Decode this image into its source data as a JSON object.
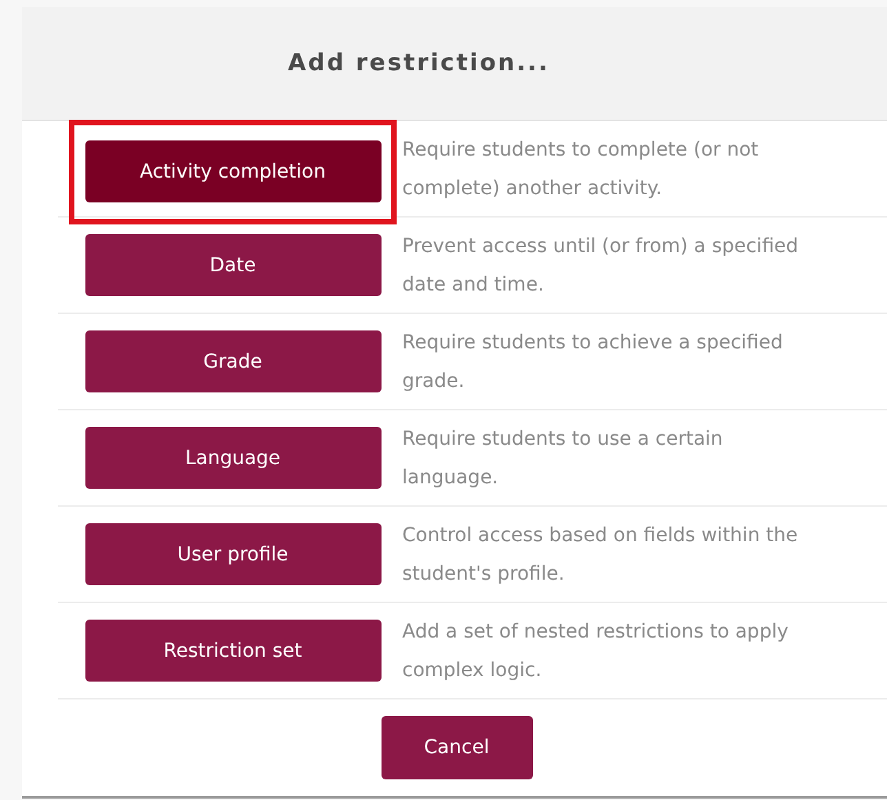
{
  "dialog": {
    "title": "Add restriction...",
    "options": [
      {
        "label": "Activity completion",
        "description": "Require students to complete (or not complete) another activity.",
        "highlighted": true
      },
      {
        "label": "Date",
        "description": "Prevent access until (or from) a specified date and time.",
        "highlighted": false
      },
      {
        "label": "Grade",
        "description": "Require students to achieve a specified grade.",
        "highlighted": false
      },
      {
        "label": "Language",
        "description": "Require students to use a certain language.",
        "highlighted": false
      },
      {
        "label": "User profile",
        "description": "Control access based on fields within the student's profile.",
        "highlighted": false
      },
      {
        "label": "Restriction set",
        "description": "Add a set of nested restrictions to apply complex logic.",
        "highlighted": false
      }
    ],
    "cancel": "Cancel"
  }
}
